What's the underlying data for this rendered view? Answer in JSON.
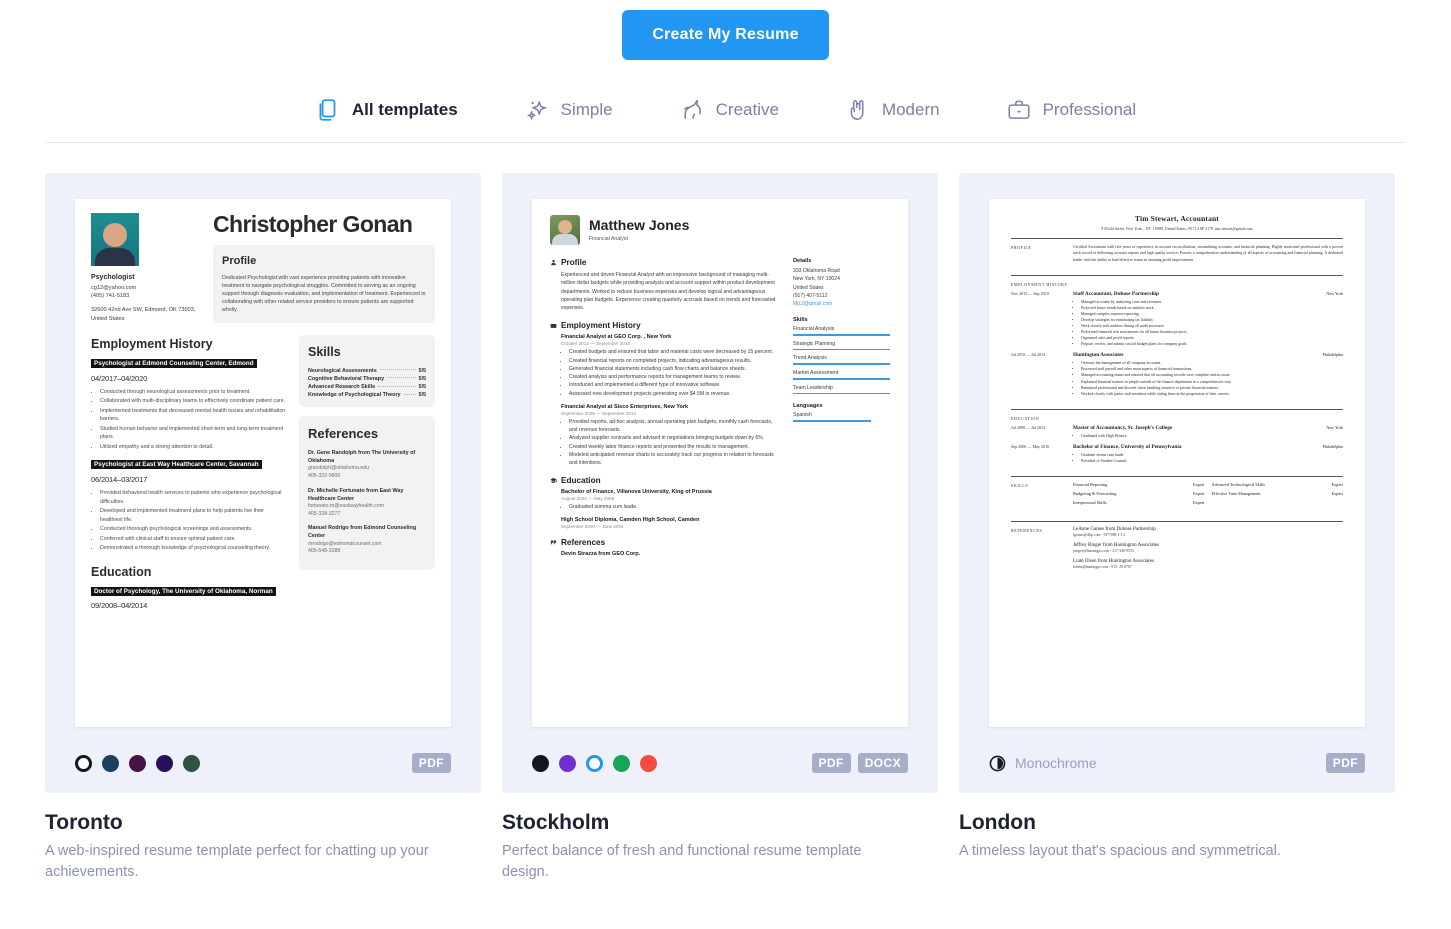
{
  "cta": {
    "label": "Create My Resume"
  },
  "tabs": [
    {
      "label": "All templates",
      "icon": "documents-icon",
      "active": true
    },
    {
      "label": "Simple",
      "icon": "sparkles-icon",
      "active": false
    },
    {
      "label": "Creative",
      "icon": "unicorn-icon",
      "active": false
    },
    {
      "label": "Modern",
      "icon": "rock-hand-icon",
      "active": false
    },
    {
      "label": "Professional",
      "icon": "briefcase-icon",
      "active": false
    }
  ],
  "cards": [
    {
      "title": "Toronto",
      "description": "A web-inspired resume template perfect for chatting up your achievements.",
      "swatches": [
        "#ffffff",
        "#1c3f5e",
        "#4a1248",
        "#2a0f5e",
        "#2f5340"
      ],
      "selected_swatch": 0,
      "badges": [
        "PDF"
      ]
    },
    {
      "title": "Stockholm",
      "description": "Perfect balance of fresh and functional resume template design.",
      "swatches": [
        "#15161f",
        "#7230d0",
        "#2196f3",
        "#18a558",
        "#f94b42"
      ],
      "selected_swatch": 2,
      "badges": [
        "PDF",
        "DOCX"
      ]
    },
    {
      "title": "London",
      "description": "A timeless layout that's spacious and symmetrical.",
      "mono_label": "Monochrome",
      "badges": [
        "PDF"
      ]
    }
  ],
  "toronto": {
    "name": "Christopher Gonan",
    "role": "Psychologist",
    "email": "cg12@yahoo.com",
    "phone": "(405) 741-5183",
    "address": "32600 42nd Ave SW, Edmond, OK 73003, United States",
    "profile_heading": "Profile",
    "profile_text": "Dedicated Psychologist with vast experience providing patients with innovative treatment to navigate psychological struggles. Committed to serving as an ongoing support through diagnosis evaluation, and implementation of treatment. Experienced in collaborating with other related service providers to ensure patients are supported wholly.",
    "employment_heading": "Employment History",
    "jobs": [
      {
        "title": "Psychologist at Edmond Counseling Center, Edmond",
        "date": "04/2017–04/2020",
        "bullets": [
          "Conducted through neurological assessments prior to treatment.",
          "Collaborated with multi-disciplinary teams to effectively coordinate patient care.",
          "Implemented treatments that decreased mental health issues and rehabilitation barriers.",
          "Studied human behavior and implemented short-term and long-term treatment plans.",
          "Utilized empathy and a strong attention to detail."
        ]
      },
      {
        "title": "Psychologist at East Way Healthcare Center, Savannah",
        "date": "06/2014–03/2017",
        "bullets": [
          "Provided behavioral health services to patients who experience psychological difficulties.",
          "Developed and implemented treatment plans to help patients live their healthiest life.",
          "Conducted thorough psychological screenings and assessments.",
          "Conferred with clinical staff to ensure optimal patient care.",
          "Demonstrated a thorough knowledge of psychological counseling theory."
        ]
      }
    ],
    "education_heading": "Education",
    "education": [
      {
        "title": "Doctor of Psychology, The University of Oklahoma, Norman",
        "date": "09/2008–04/2014"
      }
    ],
    "skills_heading": "Skills",
    "skills": [
      {
        "name": "Neurological Assessments",
        "level": "5/5"
      },
      {
        "name": "Cognitive Behavioral Therapy",
        "level": "5/5"
      },
      {
        "name": "Advanced Research Skills",
        "level": "5/5"
      },
      {
        "name": "Knowledge of Psychological Theory",
        "level": "5/5"
      }
    ],
    "references_heading": "References",
    "references": [
      {
        "name": "Dr. Gene Randolph from The University of Oklahoma",
        "email": "grandolph@oklahoma.edu",
        "phone": "405-332-9800"
      },
      {
        "name": "Dr. Michelle Fortunato from East Way Healthcare Center",
        "email": "fortunato.m@eastwayhealth.com",
        "phone": "405-328-3277"
      },
      {
        "name": "Manuel Rodrigo from Edmond Counseling Center",
        "email": "mrodrigo@edmondcounsel.com",
        "phone": "405-548-3288"
      }
    ]
  },
  "stockholm": {
    "name": "Matthew Jones",
    "role": "Financial Analyst",
    "profile_heading": "Profile",
    "profile_text": "Experienced and driven Financial Analyst with an impressive background of managing multi-million dollar budgets while providing analysis and account support within product development departments. Worked to reduce business expenses and develop logical and advantageous operating plan budgets. Experience creating quarterly accruals based on trends and forecasted expenses.",
    "employment_heading": "Employment History",
    "jobs": [
      {
        "title": "Financial Analyst at GEO Corp. , New York",
        "date": "October 2012 — September 2019",
        "bullets": [
          "Created budgets and ensured that labor and material costs were decreased by 15 percent.",
          "Created financial reports on completed projects, indicating advantageous results.",
          "Generated financial statements including cash flow charts and balance sheets.",
          "Created analysis and performance reports for management teams to review.",
          "Introduced and implemented a different type of innovative software.",
          "Assessed new development projects generating over $4.5M in revenue."
        ]
      },
      {
        "title": "Financial Analyst at Sisco Enterprises, New York",
        "date": "September 2008 — September 2012",
        "bullets": [
          "Provided reports, ad-hoc analysis, annual operating plan budgets, monthly cash forecasts, and revenue forecasts.",
          "Analyzed supplier contracts and advised in negotiations bringing budgets down by 6%.",
          "Created weekly labor finance reports and presented the results to management.",
          "Modeled anticipated revenue charts to accurately track our progress in relation to forecasts and intentions."
        ]
      }
    ],
    "education_heading": "Education",
    "education": [
      {
        "title": "Bachelor of Finance, Villanova University, King of Prussia",
        "date": "August 2004 — May 2008",
        "bullets": [
          "Graduated summa cum laude."
        ]
      },
      {
        "title": "High School Diploma, Camden High School, Camden",
        "date": "September 2000 — June 2004",
        "bullets": []
      }
    ],
    "references_heading": "References",
    "references": [
      {
        "name": "Devin Strazza from GEO Corp."
      }
    ],
    "details_heading": "Details",
    "details": [
      "333 Oklahoma Road",
      "New York, NY 10024",
      "United States",
      "(917) 407-5112"
    ],
    "details_email": "Mj12@gmail.com",
    "skills_heading": "Skills",
    "skills": [
      {
        "name": "Financial Analysis",
        "level": 100
      },
      {
        "name": "Strategic Planning",
        "level": 100
      },
      {
        "name": "Trend Analysis",
        "level": 100
      },
      {
        "name": "Market Assessment",
        "level": 100
      },
      {
        "name": "Team Leadership",
        "level": 100
      }
    ],
    "languages_heading": "Languages",
    "languages": [
      {
        "name": "Spanish",
        "level": 80
      }
    ]
  },
  "london": {
    "name": "Tim Stewart, Accountant",
    "contact": "8 0Gold Street, New York, , NY 1 0088, United States, (917) 4 0F-2179, tim.stewart@gmail.com",
    "sections": {
      "profile": "PROFILE",
      "employment": "EMPLOYMENT HISTORY",
      "education": "EDUCATION",
      "skills": "SKILLS",
      "references": "REFERENCES"
    },
    "profile_text": "Certified Accountant with five years of experience in account reconciliations, streamlining accounts, and financial planning. Highly motivated professional with a proven track record of delivering accurate reports and high quality service. Possess a comprehensive understanding of all aspects of accounting and financial planning. A dedicated leader with the ability to lead effective teams in attaining profit improvement.",
    "jobs": [
      {
        "date": "Nov 2013 — Sep 2019",
        "title": "Staff Accountant, Dubose Partnership",
        "location": "New York",
        "bullets": [
          "Managed accounts by analyzing costs and revenues.",
          "Projected future trends based on analysis work.",
          "Managed complex expense reporting.",
          "Develop strategies for minimizing tax liability.",
          "Work closely with auditors during all audit processes.",
          "Performed financial risk assessments for all future business projects.",
          "Organized sales and profit reports.",
          "Prepare, review, and submit crucial budget plans for company goals."
        ]
      },
      {
        "date": "Jul 2010 — Jul 2013",
        "title": "Huntington Associates",
        "location": "Philadelphia",
        "bullets": [
          "Oversaw the management of all company accounts.",
          "Processed staff payroll and other main aspects of financial transactions.",
          "Managed accounting teams and ensured that all accounting records were complete and accurate.",
          "Explained financial matters to people outside of the finance department in a comprehensive way.",
          "Remained professional and discreet when handling sensitive or private financial matters.",
          "Worked closely with junior staff members while aiding them in the progression of their careers."
        ]
      }
    ],
    "education": [
      {
        "date": "Jul 2009 — Jul 2013",
        "title": "Master of Accountancy, St. Joseph's College",
        "location": "New York",
        "bullets": [
          "Graduated with High Honors."
        ]
      },
      {
        "date": "Sep 2006 — May 2010",
        "title": "Bachelor of Finance, University of Pennsylvania",
        "location": "Philadelphia",
        "bullets": [
          "Graduate serena cum laude.",
          "President of Student Counsel."
        ]
      }
    ],
    "skills": [
      {
        "name": "Financial Reporting",
        "level": "Expert"
      },
      {
        "name": "Budgeting & Forecasting",
        "level": "Expert"
      },
      {
        "name": "Interpersonal Skills",
        "level": "Expert"
      },
      {
        "name": "Advanced Technological Skills",
        "level": "Expert"
      },
      {
        "name": "Effective Time Management",
        "level": "Expert"
      }
    ],
    "references": [
      {
        "name": "LeAnne Gaines from Dubose Partnership",
        "contact": "lgaines@dbp.com  -  917-988-1 3 2"
      },
      {
        "name": "Jeffrey Ringer from Huntington Associates",
        "contact": "jringer@huntingps.com  -  317-348-9533"
      },
      {
        "name": "Liam Olsen from Huntington Associates",
        "contact": "lolsen@huntingps.com  -  913- 29-8787"
      }
    ]
  }
}
